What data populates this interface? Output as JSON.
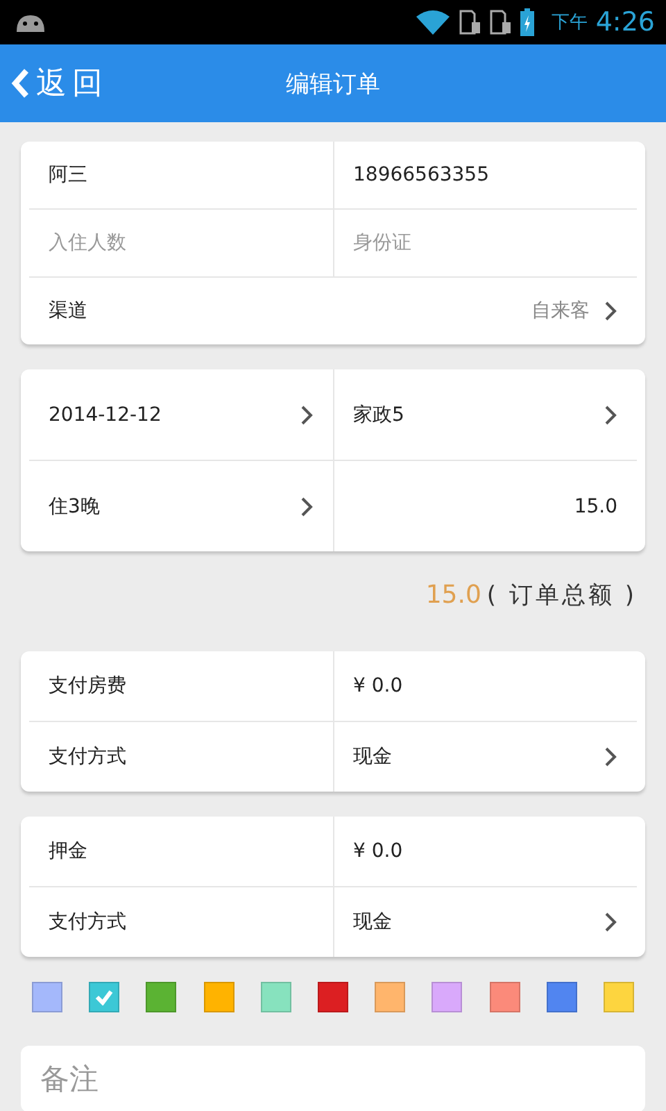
{
  "status_bar": {
    "period": "下午",
    "time": "4:26"
  },
  "header": {
    "back": "返回",
    "title": "编辑订单"
  },
  "cards": [
    {
      "kind": "contact",
      "rows": [
        {
          "kind": "pair",
          "cells": [
            {
              "kind": "text",
              "text": "阿三"
            },
            {
              "kind": "text",
              "text": "18966563355"
            }
          ]
        },
        {
          "kind": "pair",
          "cells": [
            {
              "kind": "input",
              "placeholder": "入住人数"
            },
            {
              "kind": "input",
              "placeholder": "身份证"
            }
          ]
        },
        {
          "kind": "single",
          "label": "渠道",
          "value": "自来客"
        }
      ]
    },
    {
      "kind": "stay",
      "rows": [
        {
          "kind": "pair",
          "cells": [
            {
              "kind": "link",
              "text": "2014-12-12"
            },
            {
              "kind": "link",
              "text": "家政5"
            }
          ]
        },
        {
          "kind": "pair",
          "cells": [
            {
              "kind": "link",
              "text": "住3晚"
            },
            {
              "kind": "number",
              "text": "15.0"
            }
          ]
        }
      ]
    }
  ],
  "total": {
    "amount": "15.0",
    "label": "( 订单总额 )"
  },
  "payments": [
    {
      "kind": "payment",
      "rows": [
        {
          "kind": "pair",
          "cells": [
            {
              "kind": "text",
              "text": "支付房费"
            },
            {
              "kind": "text",
              "text": "¥ 0.0"
            }
          ]
        },
        {
          "kind": "pair",
          "cells": [
            {
              "kind": "text",
              "text": "支付方式"
            },
            {
              "kind": "link",
              "text": "现金"
            }
          ]
        }
      ]
    },
    {
      "kind": "payment",
      "rows": [
        {
          "kind": "pair",
          "cells": [
            {
              "kind": "text",
              "text": "押金"
            },
            {
              "kind": "text",
              "text": "¥ 0.0"
            }
          ]
        },
        {
          "kind": "pair",
          "cells": [
            {
              "kind": "text",
              "text": "支付方式"
            },
            {
              "kind": "link",
              "text": "现金"
            }
          ]
        }
      ]
    }
  ],
  "colors": [
    {
      "color": "#a4b8fb",
      "selected": false
    },
    {
      "color": "#3cc8d6",
      "selected": true
    },
    {
      "color": "#5bb333",
      "selected": false
    },
    {
      "color": "#ffb300",
      "selected": false
    },
    {
      "color": "#87e2be",
      "selected": false
    },
    {
      "color": "#dc1f22",
      "selected": false
    },
    {
      "color": "#ffb56c",
      "selected": false
    },
    {
      "color": "#d9a9fb",
      "selected": false
    },
    {
      "color": "#fb8a7a",
      "selected": false
    },
    {
      "color": "#5185f0",
      "selected": false
    },
    {
      "color": "#fdd53f",
      "selected": false
    }
  ],
  "remark": {
    "placeholder": "备注"
  }
}
